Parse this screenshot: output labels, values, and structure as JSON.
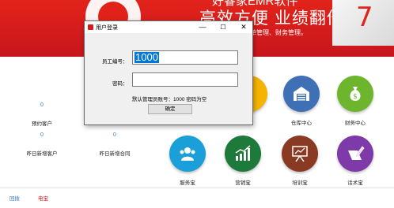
{
  "banner": {
    "top_text": "好睿家EMR软件",
    "slogan": "高效方便 业绩翻倍",
    "subtitle": "、工单管理、财务管理。",
    "win_digit": "7"
  },
  "stats": [
    {
      "value": "0",
      "label": "预约客户"
    },
    {
      "value": "0",
      "label": "昨日新增客户"
    },
    {
      "value": "0",
      "label": "昨日新增合同"
    }
  ],
  "modules": [
    {
      "label": "仓库中心",
      "color": "#3f6fb5",
      "icon": "warehouse-icon"
    },
    {
      "label": "财务中心",
      "color": "#6cb52d",
      "icon": "money-bag-icon"
    },
    {
      "label": "服务宝",
      "color": "#1a9fd8",
      "icon": "service-people-icon"
    },
    {
      "label": "营销宝",
      "color": "#1e7a3a",
      "icon": "growth-chart-icon"
    },
    {
      "label": "培训宝",
      "color": "#8a3a22",
      "icon": "training-board-icon"
    },
    {
      "label": "话术宝",
      "color": "#7d3aa8",
      "icon": "pen-paper-icon"
    }
  ],
  "footer": {
    "link1": "回拨",
    "link2": "电宝",
    "link1_color": "#3a78c3",
    "link2_color": "#d71920"
  },
  "dialog": {
    "title": "用户登录",
    "minimize": "—",
    "maximize": "☐",
    "close": "✕",
    "employee_label": "员工编号：",
    "employee_value": "1000",
    "password_label": "密码：",
    "password_value": "",
    "hint": "默认管理员账号：1000  密码为空",
    "ok_button": "确定"
  }
}
